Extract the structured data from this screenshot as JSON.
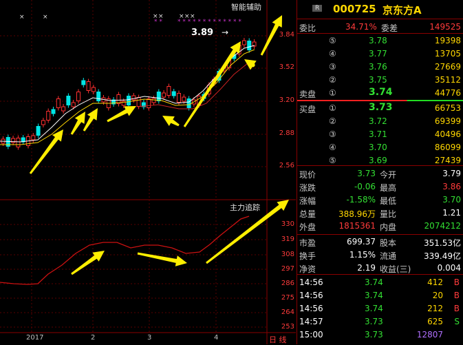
{
  "chart": {
    "indicator_label": "智能辅助",
    "lower_label": "主力追踪",
    "price_callout": "3.89",
    "y_ticks_upper": [
      "3.84",
      "3.52",
      "3.20",
      "2.88",
      "2.56"
    ],
    "y_ticks_lower": [
      "330",
      "319",
      "308",
      "297",
      "286",
      "275",
      "264",
      "253"
    ],
    "x_ticks": [
      "2017",
      "2",
      "3",
      "4"
    ],
    "corner_label": "日 线",
    "colors": {
      "up": "#ff3030",
      "down": "#00e5e5",
      "ma_white": "#ffffff",
      "ma_yellow": "#ffd700",
      "arrow": "#ffee00"
    }
  },
  "quote": {
    "badge": "R",
    "code": "000725",
    "name": "京东方A",
    "weibi_label": "委比",
    "weibi_value": "34.71%",
    "weicha_label": "委差",
    "weicha_value": "149525",
    "sell_label": "卖盘",
    "buy_label": "买盘",
    "sell": [
      {
        "n": "⑤",
        "price": "3.78",
        "vol": "19398"
      },
      {
        "n": "④",
        "price": "3.77",
        "vol": "13705"
      },
      {
        "n": "③",
        "price": "3.76",
        "vol": "27669"
      },
      {
        "n": "②",
        "price": "3.75",
        "vol": "35112"
      },
      {
        "n": "①",
        "price": "3.74",
        "vol": "44776"
      }
    ],
    "buy": [
      {
        "n": "①",
        "price": "3.73",
        "vol": "66753"
      },
      {
        "n": "②",
        "price": "3.72",
        "vol": "69399"
      },
      {
        "n": "③",
        "price": "3.71",
        "vol": "40496"
      },
      {
        "n": "④",
        "price": "3.70",
        "vol": "86099"
      },
      {
        "n": "⑤",
        "price": "3.69",
        "vol": "27439"
      }
    ],
    "stats": [
      {
        "l1": "现价",
        "v1": "3.73",
        "l2": "今开",
        "v2": "3.79"
      },
      {
        "l1": "涨跌",
        "v1": "-0.06",
        "l2": "最高",
        "v2": "3.86"
      },
      {
        "l1": "涨幅",
        "v1": "-1.58%",
        "l2": "最低",
        "v2": "3.70"
      },
      {
        "l1": "总量",
        "v1": "388.96万",
        "l2": "量比",
        "v2": "1.21"
      },
      {
        "l1": "外盘",
        "v1": "1815361",
        "l2": "内盘",
        "v2": "2074212"
      }
    ],
    "fund": [
      {
        "l1": "市盈",
        "v1": "699.37",
        "l2": "股本",
        "v2": "351.53亿"
      },
      {
        "l1": "换手",
        "v1": "1.15%",
        "l2": "流通",
        "v2": "339.49亿"
      },
      {
        "l1": "净资",
        "v1": "2.19",
        "l2": "收益(三)",
        "v2": "0.004"
      }
    ],
    "ticks": [
      {
        "time": "14:56",
        "price": "3.74",
        "vol": "412",
        "side": "B"
      },
      {
        "time": "14:56",
        "price": "3.74",
        "vol": "20",
        "side": "B"
      },
      {
        "time": "14:56",
        "price": "3.74",
        "vol": "212",
        "side": "B"
      },
      {
        "time": "14:57",
        "price": "3.73",
        "vol": "625",
        "side": "S"
      },
      {
        "time": "15:00",
        "price": "3.73",
        "vol": "12807",
        "side": ""
      }
    ]
  }
}
